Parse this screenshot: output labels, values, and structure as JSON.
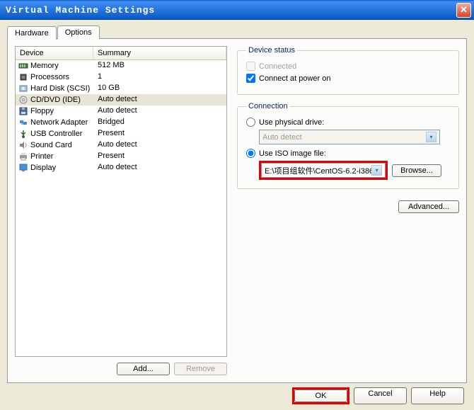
{
  "window": {
    "title": "Virtual Machine Settings"
  },
  "tabs": {
    "hardware": "Hardware",
    "options": "Options"
  },
  "deviceList": {
    "headers": {
      "device": "Device",
      "summary": "Summary"
    },
    "rows": [
      {
        "device": "Memory",
        "summary": "512 MB"
      },
      {
        "device": "Processors",
        "summary": "1"
      },
      {
        "device": "Hard Disk (SCSI)",
        "summary": "10 GB"
      },
      {
        "device": "CD/DVD (IDE)",
        "summary": "Auto detect"
      },
      {
        "device": "Floppy",
        "summary": "Auto detect"
      },
      {
        "device": "Network Adapter",
        "summary": "Bridged"
      },
      {
        "device": "USB Controller",
        "summary": "Present"
      },
      {
        "device": "Sound Card",
        "summary": "Auto detect"
      },
      {
        "device": "Printer",
        "summary": "Present"
      },
      {
        "device": "Display",
        "summary": "Auto detect"
      }
    ]
  },
  "leftButtons": {
    "add": "Add...",
    "remove": "Remove"
  },
  "deviceStatus": {
    "legend": "Device status",
    "connected": "Connected",
    "connectAtPowerOn": "Connect at power on"
  },
  "connection": {
    "legend": "Connection",
    "usePhysical": "Use physical drive:",
    "physicalValue": "Auto detect",
    "useIso": "Use ISO image file:",
    "isoValue": "E:\\项目组软件\\CentOS-6.2-i386",
    "browse": "Browse..."
  },
  "advanced": "Advanced...",
  "bottomButtons": {
    "ok": "OK",
    "cancel": "Cancel",
    "help": "Help"
  }
}
